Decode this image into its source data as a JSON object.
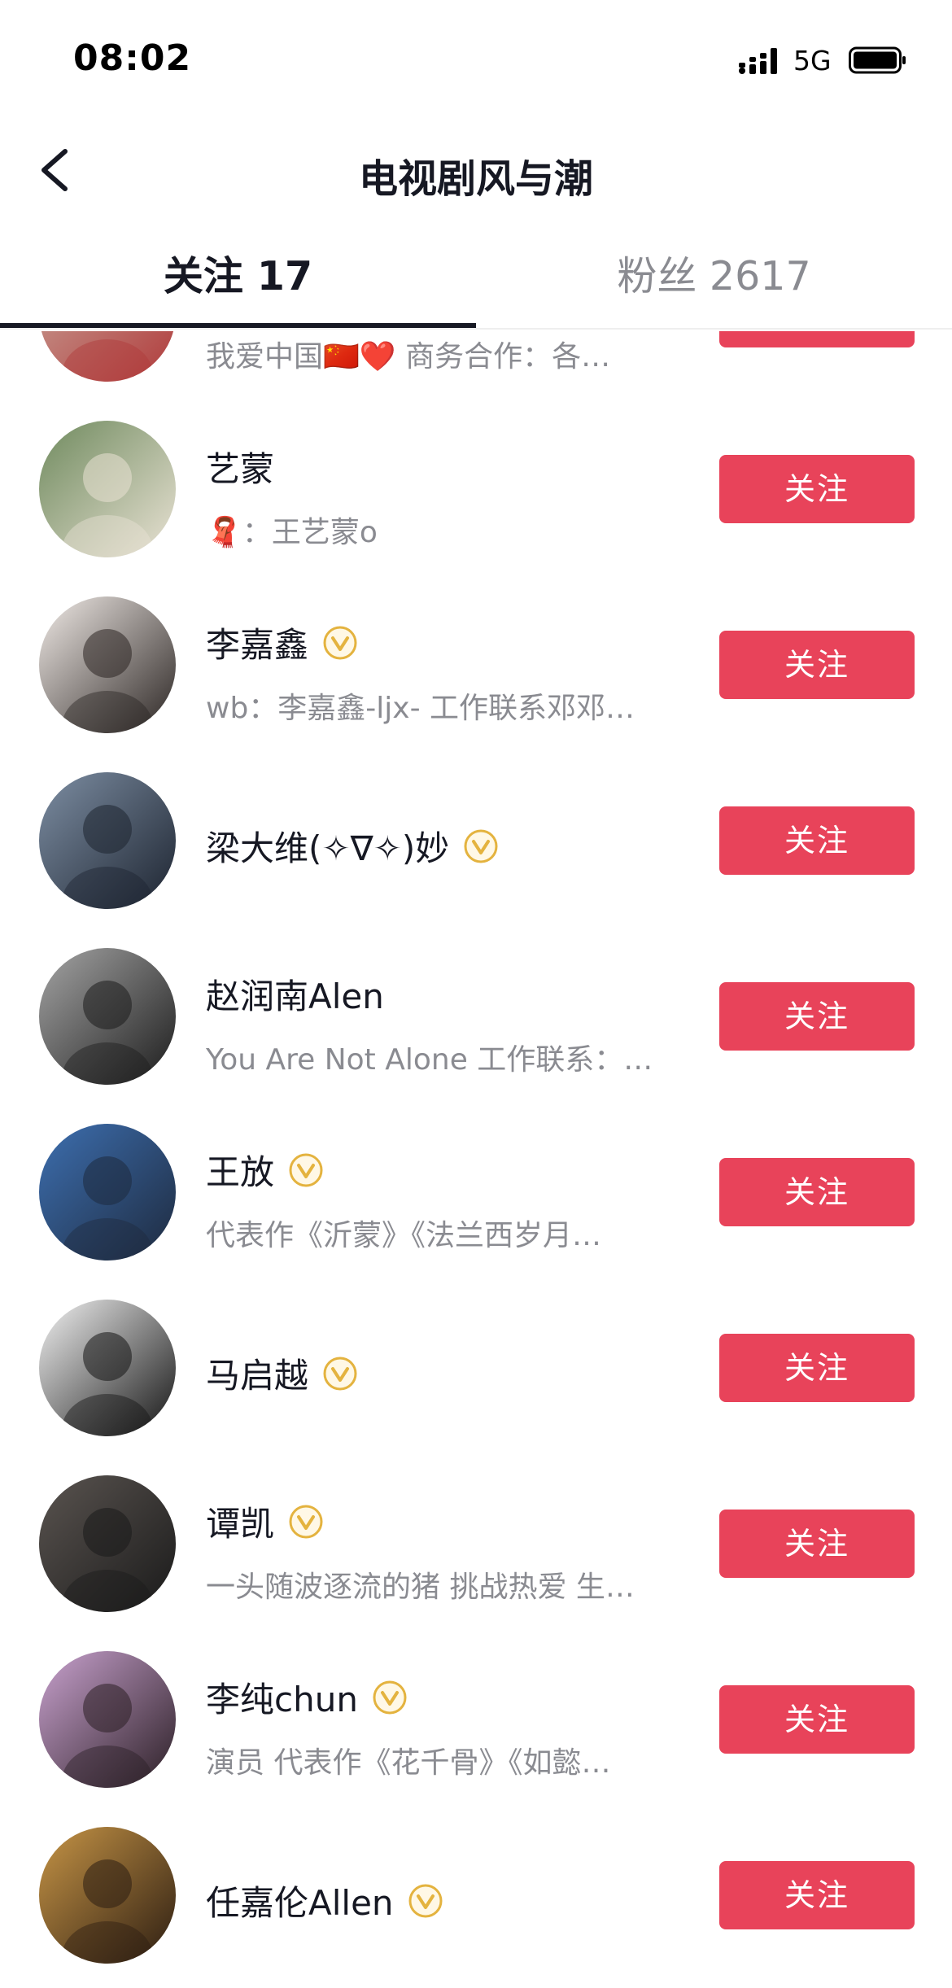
{
  "status_bar": {
    "time": "08:02",
    "network": "5G"
  },
  "nav": {
    "title": "电视剧风与潮"
  },
  "tabs": [
    {
      "label": "关注 17",
      "active": true
    },
    {
      "label": "粉丝 2617",
      "active": false
    }
  ],
  "accent_color": "#e8435a",
  "follow_label": "关注",
  "users": [
    {
      "name": "",
      "verified": false,
      "signature": "我爱中国🇨🇳❤️ 商务合作：各…",
      "avatar_colors": [
        "#c9a79c",
        "#b03a3a"
      ]
    },
    {
      "name": "艺蒙",
      "verified": false,
      "signature": "🧣：王艺蒙o",
      "avatar_colors": [
        "#6f8a5e",
        "#e9e2d4"
      ]
    },
    {
      "name": "李嘉鑫",
      "verified": true,
      "signature": "wb：李嘉鑫-ljx- 工作联系邓邓…",
      "avatar_colors": [
        "#f1ebe7",
        "#2b2523"
      ]
    },
    {
      "name": "梁大维(✧∇✧)妙",
      "verified": true,
      "signature": "",
      "avatar_colors": [
        "#7d8ea3",
        "#1d2430"
      ]
    },
    {
      "name": "赵润南Alen",
      "verified": false,
      "signature": "You Are Not Alone 工作联系：…",
      "avatar_colors": [
        "#a5a5a5",
        "#1c1c1c"
      ]
    },
    {
      "name": "王放",
      "verified": true,
      "signature": "代表作《沂蒙》《法兰西岁月…",
      "avatar_colors": [
        "#3d6fb0",
        "#1e2a3e"
      ]
    },
    {
      "name": "马启越",
      "verified": true,
      "signature": "",
      "avatar_colors": [
        "#f3f3f3",
        "#141414"
      ]
    },
    {
      "name": "谭凯",
      "verified": true,
      "signature": "一头随波逐流的猪 挑战热爱 生…",
      "avatar_colors": [
        "#5a5450",
        "#1a1a1a"
      ]
    },
    {
      "name": "李纯chun",
      "verified": true,
      "signature": "演员  代表作《花千骨》《如懿…",
      "avatar_colors": [
        "#c9a2cf",
        "#2b1f25"
      ]
    },
    {
      "name": "任嘉伦Allen",
      "verified": true,
      "signature": "",
      "avatar_colors": [
        "#c79546",
        "#2c1d12"
      ]
    }
  ]
}
